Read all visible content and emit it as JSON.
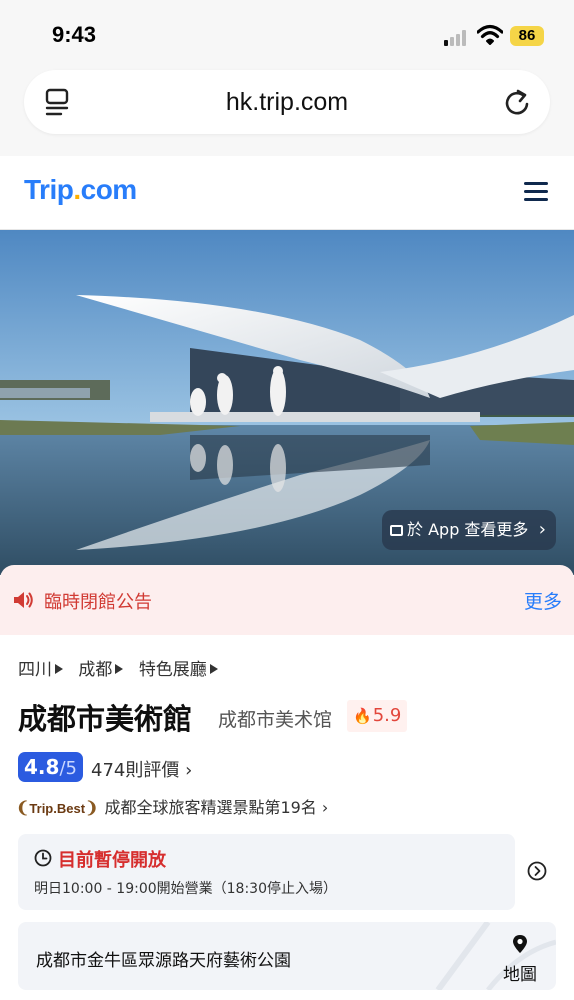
{
  "status_bar": {
    "time": "9:43",
    "battery": "86"
  },
  "browser": {
    "url": "hk.trip.com"
  },
  "site": {
    "logo_main": "Trip",
    "logo_dot": ".",
    "logo_suffix": "com"
  },
  "hero": {
    "app_cta": "於 App 查看更多"
  },
  "notice": {
    "text": "臨時閉館公告",
    "more": "更多"
  },
  "breadcrumb": [
    "四川",
    "成都",
    "特色展廳"
  ],
  "attraction": {
    "name": "成都市美術館",
    "alt_name": "成都市美术馆",
    "hot_score": "5.9",
    "rating": "4.8",
    "rating_max": "/5",
    "reviews": "474則評價",
    "badge": "Trip.Best",
    "ranking": "成都全球旅客精選景點第19名"
  },
  "hours": {
    "status": "目前暫停開放",
    "detail": "明日10:00 - 19:00開始營業（18:30停止入場）"
  },
  "address": {
    "text": "成都市金牛區眾源路天府藝術公園",
    "map_label": "地圖"
  },
  "colors": {
    "brand": "#287dfa",
    "accent_dot": "#ffb000",
    "alert": "#d13b34",
    "score_bg": "#2b5be0"
  }
}
